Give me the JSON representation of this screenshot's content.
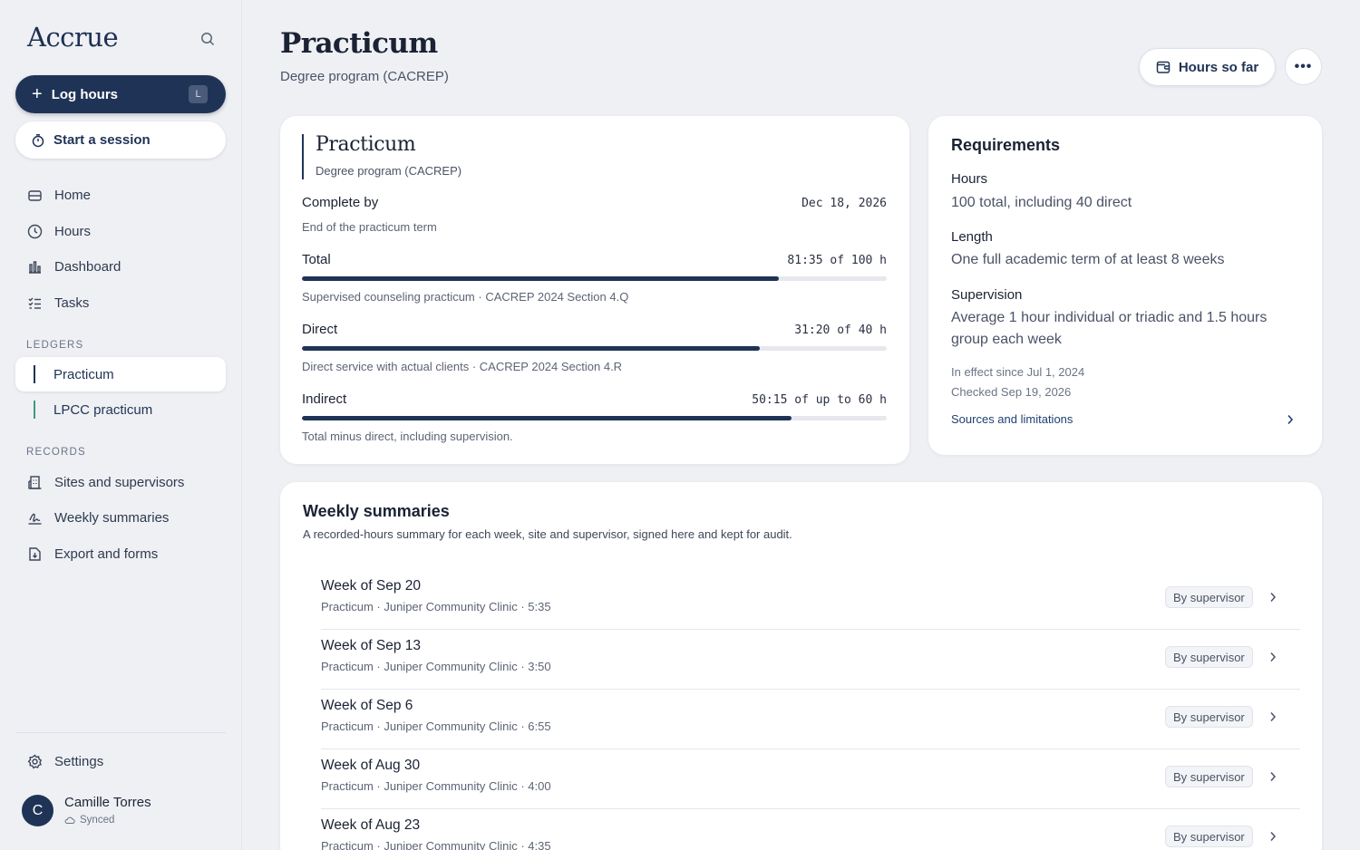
{
  "app": {
    "name": "Accrue"
  },
  "sidebar": {
    "log_hours": {
      "label": "Log hours",
      "shortcut": "L"
    },
    "start_session": {
      "label": "Start a session"
    },
    "nav": [
      {
        "label": "Home",
        "icon": "home-icon"
      },
      {
        "label": "Hours",
        "icon": "clock-icon"
      },
      {
        "label": "Dashboard",
        "icon": "chart-icon"
      },
      {
        "label": "Tasks",
        "icon": "tasks-icon"
      }
    ],
    "ledgers_heading": "LEDGERS",
    "ledgers": [
      {
        "label": "Practicum",
        "active": true,
        "bar_color": "#1f3356"
      },
      {
        "label": "LPCC practicum",
        "active": false,
        "bar_color": "#3f9a78"
      }
    ],
    "records_heading": "RECORDS",
    "records": [
      {
        "label": "Sites and supervisors",
        "icon": "building-icon"
      },
      {
        "label": "Weekly summaries",
        "icon": "signature-icon"
      },
      {
        "label": "Export and forms",
        "icon": "file-export-icon"
      }
    ],
    "settings": {
      "label": "Settings"
    },
    "user": {
      "initial": "C",
      "name": "Camille Torres",
      "status": "Synced"
    }
  },
  "header": {
    "title": "Practicum",
    "subtitle": "Degree program (CACREP)",
    "hours_button": "Hours so far",
    "more_button": "•••"
  },
  "progress_card": {
    "title": "Practicum",
    "subtitle": "Degree program (CACREP)",
    "complete_by": {
      "label": "Complete by",
      "value": "Dec 18, 2026",
      "note": "End of the practicum term"
    },
    "rows": [
      {
        "label": "Total",
        "value": "81:35 of 100 h",
        "progress": 0.816,
        "note": "Supervised counseling practicum · CACREP 2024 Section 4.Q"
      },
      {
        "label": "Direct",
        "value": "31:20 of 40 h",
        "progress": 0.783,
        "note": "Direct service with actual clients · CACREP 2024 Section 4.R"
      },
      {
        "label": "Indirect",
        "value": "50:15 of up to 60 h",
        "progress": 0.837,
        "note": "Total minus direct, including supervision."
      }
    ]
  },
  "requirements": {
    "title": "Requirements",
    "hours_label": "Hours",
    "hours_value": "100 total, including 40 direct",
    "length_label": "Length",
    "length_value": "One full academic term of at least 8 weeks",
    "supervision_label": "Supervision",
    "supervision_value": "Average 1 hour individual or triadic and 1.5 hours group each week",
    "effective": "In effect since Jul 1, 2024",
    "checked": "Checked Sep 19, 2026",
    "link": "Sources and limitations"
  },
  "weekly": {
    "title": "Weekly summaries",
    "subtitle": "A recorded-hours summary for each week, site and supervisor, signed here and kept for audit.",
    "rows": [
      {
        "title": "Week of Sep 20",
        "meta": "Practicum · Juniper Community Clinic · 5:35",
        "badge": "By supervisor"
      },
      {
        "title": "Week of Sep 13",
        "meta": "Practicum · Juniper Community Clinic · 3:50",
        "badge": "By supervisor"
      },
      {
        "title": "Week of Sep 6",
        "meta": "Practicum · Juniper Community Clinic · 6:55",
        "badge": "By supervisor"
      },
      {
        "title": "Week of Aug 30",
        "meta": "Practicum · Juniper Community Clinic · 4:00",
        "badge": "By supervisor"
      },
      {
        "title": "Week of Aug 23",
        "meta": "Practicum · Juniper Community Clinic · 4:35",
        "badge": "By supervisor"
      }
    ]
  }
}
